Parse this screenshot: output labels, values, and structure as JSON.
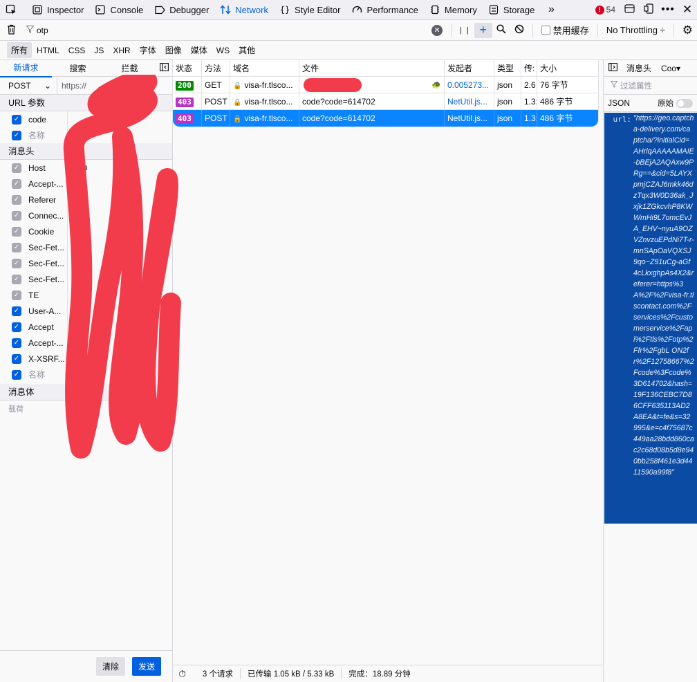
{
  "toolbar": {
    "tools": [
      {
        "name": "picker",
        "label": ""
      },
      {
        "name": "inspector",
        "label": "Inspector"
      },
      {
        "name": "console",
        "label": "Console"
      },
      {
        "name": "debugger",
        "label": "Debugger"
      },
      {
        "name": "network",
        "label": "Network"
      },
      {
        "name": "style-editor",
        "label": "Style Editor"
      },
      {
        "name": "performance",
        "label": "Performance"
      },
      {
        "name": "memory",
        "label": "Memory"
      },
      {
        "name": "storage",
        "label": "Storage"
      }
    ],
    "error_count": "54",
    "accent": "#0061e0"
  },
  "filter": {
    "value": "otp",
    "disable_cache_label": "禁用缓存",
    "throttling": "No Throttling ÷"
  },
  "types": [
    "所有",
    "HTML",
    "CSS",
    "JS",
    "XHR",
    "字体",
    "图像",
    "媒体",
    "WS",
    "其他"
  ],
  "left": {
    "tabs": [
      "新请求",
      "搜索",
      "拦截"
    ],
    "method": "POST",
    "url": "https://",
    "url_params_title": "URL 参数",
    "params": [
      {
        "name": "code",
        "value": "",
        "checked": true,
        "dim": false
      },
      {
        "name": "名称",
        "value": "",
        "checked": true,
        "dim": true
      }
    ],
    "headers_title": "消息头",
    "headers": [
      {
        "name": "Host",
        "value": "com",
        "checked": false
      },
      {
        "name": "Accept-...",
        "value": "",
        "checked": false
      },
      {
        "name": "Referer",
        "value": "onta",
        "checked": false
      },
      {
        "name": "Connec...",
        "value": "",
        "checked": false
      },
      {
        "name": "Cookie",
        "value": "",
        "checked": false
      },
      {
        "name": "Sec-Fet...",
        "value": "",
        "checked": false
      },
      {
        "name": "Sec-Fet...",
        "value": "",
        "checked": false
      },
      {
        "name": "Sec-Fet...",
        "value": "",
        "checked": false
      },
      {
        "name": "TE",
        "value": "",
        "checked": false
      },
      {
        "name": "User-A...",
        "value": "",
        "checked": true
      },
      {
        "name": "Accept",
        "value": "",
        "checked": true
      },
      {
        "name": "Accept-...",
        "value": "",
        "checked": true
      },
      {
        "name": "X-XSRF...",
        "value": "",
        "checked": true
      },
      {
        "name": "名称",
        "value": "",
        "checked": true,
        "dim": true
      }
    ],
    "body_title": "消息体",
    "body_placeholder": "载荷",
    "clear_label": "清除",
    "send_label": "发送"
  },
  "table": {
    "headers": [
      "状态",
      "方法",
      "域名",
      "文件",
      "发起者",
      "类型",
      "传:",
      "大小"
    ],
    "rows": [
      {
        "status": "200",
        "status_color": "#058b00",
        "method": "GET",
        "domain": "visa-fr.tlsco...",
        "file": "",
        "initiator": "0.005273...",
        "type": "json",
        "transferred": "2.6",
        "size": "76 字节",
        "selected": false
      },
      {
        "status": "403",
        "status_color": "#b832c4",
        "method": "POST",
        "domain": "visa-fr.tlsco...",
        "file": "code?code=614702",
        "initiator": "NetUtil.js...",
        "type": "json",
        "transferred": "1.3:",
        "size": "486 字节",
        "selected": false
      },
      {
        "status": "403",
        "status_color": "#b832c4",
        "method": "POST",
        "domain": "visa-fr.tlsco...",
        "file": "code?code=614702",
        "initiator": "NetUtil.js...",
        "type": "json",
        "transferred": "1.3:",
        "size": "486 字节",
        "selected": true
      }
    ]
  },
  "status": {
    "requests": "3 个请求",
    "transferred": "已传输 1.05 kB / 5.33 kB",
    "finish": "完成：18.89 分钟"
  },
  "right": {
    "tabs": [
      "消息头",
      "Coo▾"
    ],
    "filter_placeholder": "过滤属性",
    "json_label": "JSON",
    "raw_label": "原始",
    "url_key": "url:",
    "url_value": "\"https://geo.captcha-delivery.com/captcha/?initialCid=AHrlqAAAAAMAIE-bBEjA2AQAxw9PRg==&cid=5LAYXpmjCZAJ6mkk46dzTqx3W0D36ak_Jxjk1ZGkcvhP8KWWmHi9L7omcEvJA_EHV~nyuA9OZVZnvzuEPdNi7T-r-mnSApOaVQXSJ9qo~Z91uCg-aGf4cLkxghpAs4X2&referer=https%3A%2F%2Fvisa-fr.tlscontact.com%2Fservices%2Fcustomerservice%2Fapi%2Ftls%2Fotp%2Ffr%2FgbL ON2fr%2F12758667%2Fcode%3Fcode%3D614702&hash=19F136CEBC7D86CFF635113AD2A8EA&t=fe&s=32995&e=c4f75687c449aa28bdd860cac2c68d08b5d8e940bb258f461e3d4411590a99f8\""
  }
}
